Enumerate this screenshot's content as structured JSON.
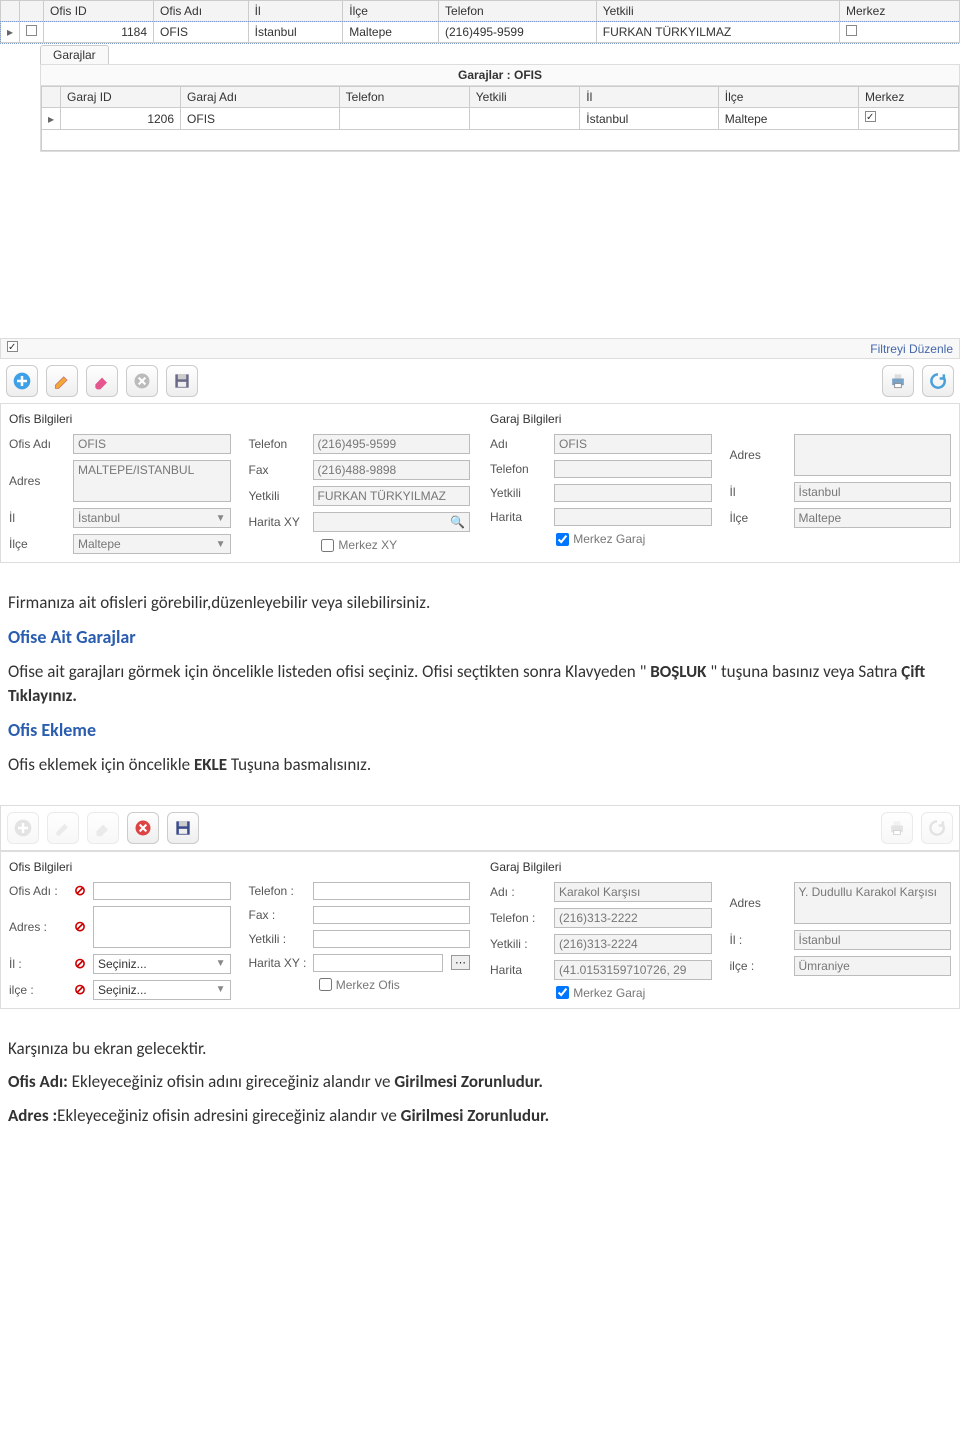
{
  "ofis_grid": {
    "headers": [
      "Ofis ID",
      "Ofis Adı",
      "İl",
      "İlçe",
      "Telefon",
      "Yetkili",
      "Merkez"
    ],
    "row": {
      "id": "1184",
      "name": "OFIS",
      "il": "İstanbul",
      "ilce": "Maltepe",
      "telefon": "(216)495-9599",
      "yetkili": "FURKAN TÜRKYILMAZ"
    }
  },
  "garaj_tab": "Garajlar",
  "garaj_panel_title": "Garajlar : OFIS",
  "garaj_grid": {
    "headers": [
      "Garaj ID",
      "Garaj Adı",
      "Telefon",
      "Yetkili",
      "İl",
      "İlçe",
      "Merkez"
    ],
    "row": {
      "id": "1206",
      "name": "OFIS",
      "telefon": "",
      "yetkili": "",
      "il": "İstanbul",
      "ilce": "Maltepe"
    }
  },
  "filter_link": "Filtreyi Düzenle",
  "form1": {
    "ofis_title": "Ofis Bilgileri",
    "garaj_title": "Garaj Bilgileri",
    "labels": {
      "ofis_adi": "Ofis Adı",
      "adres": "Adres",
      "il": "İl",
      "ilce": "İlçe",
      "telefon": "Telefon",
      "fax": "Fax",
      "yetkili": "Yetkili",
      "haritaxy": "Harita XY",
      "merkezxy": "Merkez XY",
      "adi": "Adı",
      "harita": "Harita",
      "merkez_garaj": "Merkez Garaj"
    },
    "values": {
      "ofis_adi": "OFIS",
      "adres": "MALTEPE/ISTANBUL",
      "il": "İstanbul",
      "ilce": "Maltepe",
      "telefon": "(216)495-9599",
      "fax": "(216)488-9898",
      "yetkili": "FURKAN TÜRKYILMAZ",
      "g_adi": "OFIS",
      "g_telefon": "",
      "g_yetkili": "",
      "g_adres": "",
      "g_il": "İstanbul",
      "g_ilce": "Maltepe"
    }
  },
  "doc": {
    "p1": "Firmanıza ait ofisleri görebilir,düzenleyebilir veya silebilirsiniz.",
    "h1": "Ofise Ait Garajlar",
    "p2a": "Ofise ait garajları görmek için  öncelikle listeden ofisi seçiniz. Ofisi seçtikten sonra Klavyeden \" ",
    "p2b": "BOŞLUK",
    "p2c": " \" tuşuna basınız veya Satıra ",
    "p2d": "Çift Tıklayınız.",
    "h2": "Ofis Ekleme",
    "p3a": "Ofis eklemek için öncelikle ",
    "p3b": "EKLE",
    "p3c": " Tuşuna basmalısınız.",
    "p4": "Karşınıza bu ekran gelecektir.",
    "p5a": "Ofis Adı:",
    "p5b": " Ekleyeceğiniz ofisin adını gireceğiniz alandır ve ",
    "p5c": "Girilmesi Zorunludur.",
    "p6a": "Adres :",
    "p6b": "Ekleyeceğiniz ofisin adresini gireceğiniz alandır ve ",
    "p6c": "Girilmesi Zorunludur."
  },
  "form2": {
    "ofis_title": "Ofis Bilgileri",
    "garaj_title": "Garaj Bilgileri",
    "labels": {
      "ofis_adi": "Ofis Adı :",
      "adres": "Adres :",
      "il": "İl :",
      "ilce": "ilçe :",
      "telefon": "Telefon :",
      "fax": "Fax :",
      "yetkili": "Yetkili :",
      "haritaxy": "Harita XY :",
      "merkez_ofis": "Merkez Ofis",
      "adi": "Adı :",
      "harita": "Harita",
      "merkez_garaj": "Merkez Garaj"
    },
    "values": {
      "il_placeholder": "Seçiniz...",
      "ilce_placeholder": "Seçiniz...",
      "g_adi": "Karakol Karşısı",
      "g_telefon": "(216)313-2222",
      "g_yetkili": "(216)313-2224",
      "g_harita": "(41.0153159710726, 29",
      "g_adres": "Y. Dudullu Karakol Karşısı",
      "g_il": "İstanbul",
      "g_ilce": "Ümraniye"
    }
  }
}
